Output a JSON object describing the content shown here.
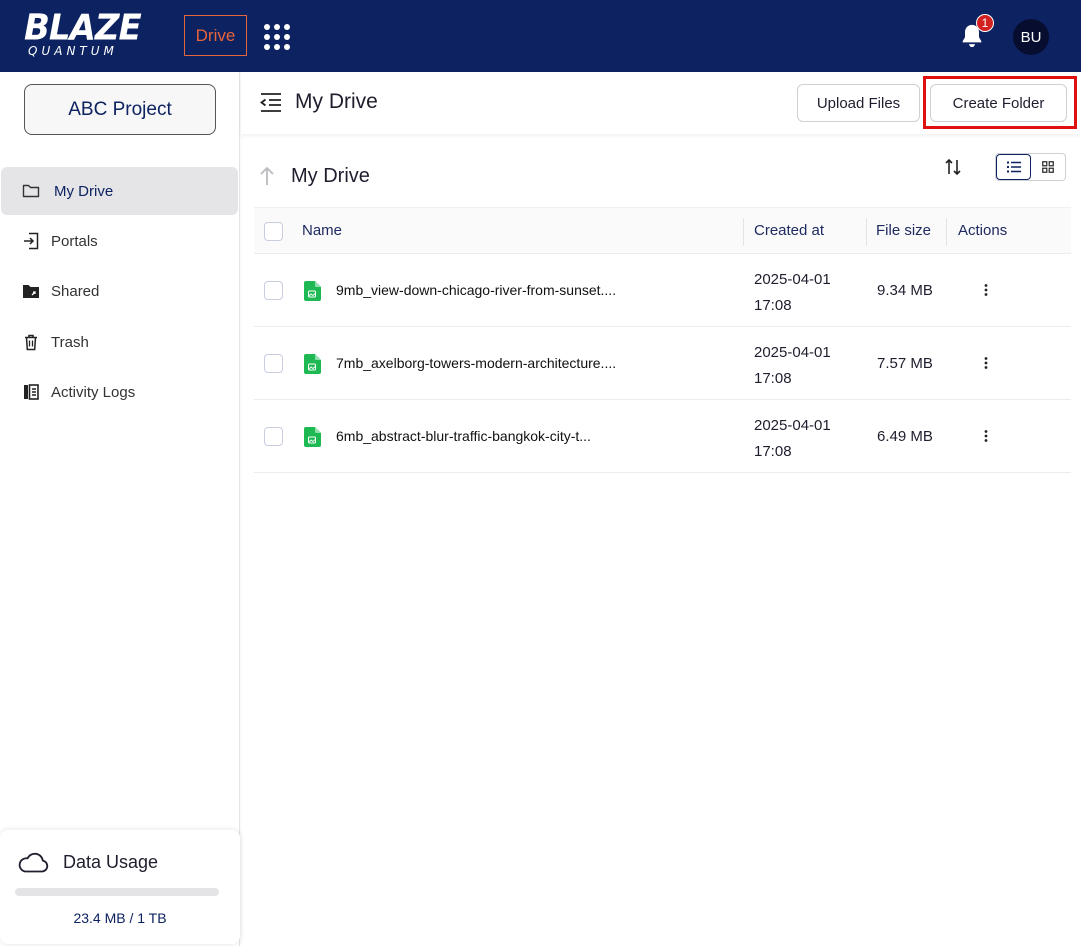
{
  "app": {
    "logo_main": "BLAZE",
    "logo_sub": "QUANTUM",
    "drive_label": "Drive",
    "notification_count": "1",
    "avatar_initials": "BU"
  },
  "sidebar": {
    "project_label": "ABC Project",
    "items": [
      {
        "label": "My Drive",
        "icon": "folder-icon",
        "active": true
      },
      {
        "label": "Portals",
        "icon": "portal-icon",
        "active": false
      },
      {
        "label": "Shared",
        "icon": "shared-folder-icon",
        "active": false
      },
      {
        "label": "Trash",
        "icon": "trash-icon",
        "active": false
      },
      {
        "label": "Activity Logs",
        "icon": "activity-logs-icon",
        "active": false
      }
    ],
    "usage": {
      "title": "Data Usage",
      "text": "23.4 MB / 1 TB",
      "fraction": 2.34e-05
    }
  },
  "header": {
    "title": "My Drive",
    "upload_label": "Upload Files",
    "create_folder_label": "Create Folder"
  },
  "breadcrumb": {
    "title": "My Drive"
  },
  "table": {
    "columns": {
      "name": "Name",
      "created": "Created at",
      "size": "File size",
      "actions": "Actions"
    },
    "rows": [
      {
        "name": "9mb_view-down-chicago-river-from-sunset....",
        "date": "2025-04-01",
        "time": "17:08",
        "size": "9.34 MB"
      },
      {
        "name": "7mb_axelborg-towers-modern-architecture....",
        "date": "2025-04-01",
        "time": "17:08",
        "size": "7.57 MB"
      },
      {
        "name": "6mb_abstract-blur-traffic-bangkok-city-t...",
        "date": "2025-04-01",
        "time": "17:08",
        "size": "6.49 MB"
      }
    ]
  },
  "colors": {
    "brand_navy": "#0d2260",
    "accent_orange": "#e8643a",
    "file_green": "#1fb954",
    "highlight_red": "#e01010"
  }
}
